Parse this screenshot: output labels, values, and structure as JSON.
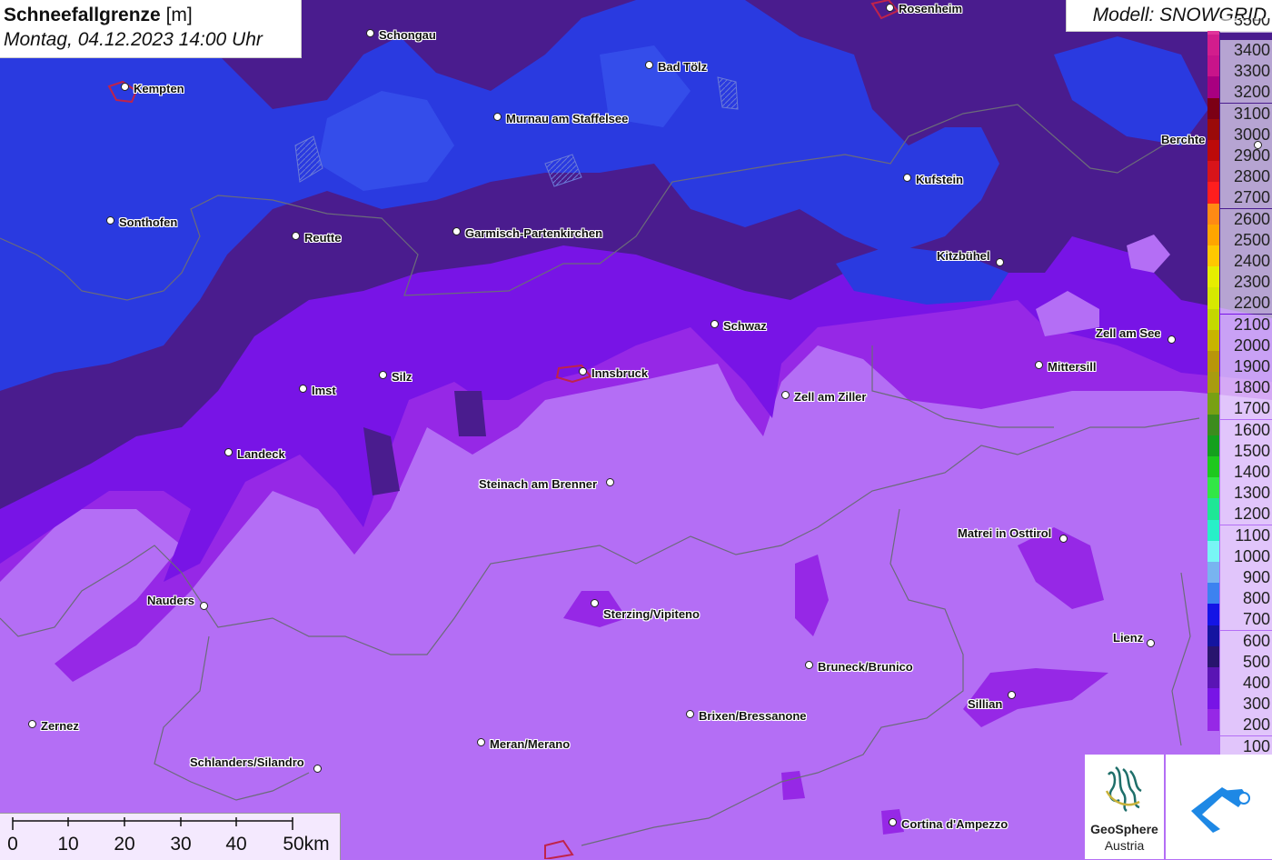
{
  "header": {
    "title_bold": "Schneefallgrenze",
    "title_unit": "[m]",
    "datetime": "Montag, 04.12.2023 14:00 Uhr",
    "model": "Modell: SNOWGRID"
  },
  "legend": {
    "top_partial": "3500",
    "entries": [
      {
        "value": "3400",
        "color": "#d21d8d"
      },
      {
        "value": "3300",
        "color": "#c8148a"
      },
      {
        "value": "3200",
        "color": "#a80080"
      },
      {
        "value": "3100",
        "color": "#7c0015"
      },
      {
        "value": "3000",
        "color": "#9b0a0a"
      },
      {
        "value": "2900",
        "color": "#bd0a0a"
      },
      {
        "value": "2800",
        "color": "#d8141a"
      },
      {
        "value": "2700",
        "color": "#ff1e1e"
      },
      {
        "value": "2600",
        "color": "#ff8a14"
      },
      {
        "value": "2500",
        "color": "#ffa500"
      },
      {
        "value": "2400",
        "color": "#ffc800"
      },
      {
        "value": "2300",
        "color": "#e6ee00"
      },
      {
        "value": "2200",
        "color": "#d6e800"
      },
      {
        "value": "2100",
        "color": "#c4d800"
      },
      {
        "value": "2000",
        "color": "#c8b400"
      },
      {
        "value": "1900",
        "color": "#b8960a"
      },
      {
        "value": "1800",
        "color": "#a89c10"
      },
      {
        "value": "1700",
        "color": "#78a014"
      },
      {
        "value": "1600",
        "color": "#3c8c1e"
      },
      {
        "value": "1500",
        "color": "#14a01e"
      },
      {
        "value": "1400",
        "color": "#1ec81e"
      },
      {
        "value": "1300",
        "color": "#32e646"
      },
      {
        "value": "1200",
        "color": "#1ee696"
      },
      {
        "value": "1100",
        "color": "#28f0c8"
      },
      {
        "value": "1000",
        "color": "#78f5f5"
      },
      {
        "value": "900",
        "color": "#78b4f0"
      },
      {
        "value": "800",
        "color": "#3c82f0"
      },
      {
        "value": "700",
        "color": "#1414e6"
      },
      {
        "value": "600",
        "color": "#1414a0"
      },
      {
        "value": "500",
        "color": "#28146e"
      },
      {
        "value": "400",
        "color": "#5a14b4"
      },
      {
        "value": "300",
        "color": "#7814e6"
      },
      {
        "value": "200",
        "color": "#9628e6"
      },
      {
        "value": "100",
        "color": "#b46ef5"
      }
    ]
  },
  "cities": [
    {
      "name": "Rosenheim"
    },
    {
      "name": "Schongau"
    },
    {
      "name": "Kempten"
    },
    {
      "name": "Bad Tölz"
    },
    {
      "name": "Murnau am Staffelsee"
    },
    {
      "name": "Berchte"
    },
    {
      "name": "Kufstein"
    },
    {
      "name": "Sonthofen"
    },
    {
      "name": "Reutte"
    },
    {
      "name": "Garmisch-Partenkirchen"
    },
    {
      "name": "Kitzbühel"
    },
    {
      "name": "Schwaz"
    },
    {
      "name": "Zell am See"
    },
    {
      "name": "Mittersill"
    },
    {
      "name": "Innsbruck"
    },
    {
      "name": "Silz"
    },
    {
      "name": "Imst"
    },
    {
      "name": "Zell am Ziller"
    },
    {
      "name": "Landeck"
    },
    {
      "name": "Steinach am Brenner"
    },
    {
      "name": "Matrei in Osttirol"
    },
    {
      "name": "Nauders"
    },
    {
      "name": "Sterzing/Vipiteno"
    },
    {
      "name": "Lienz"
    },
    {
      "name": "Bruneck/Brunico"
    },
    {
      "name": "Sillian"
    },
    {
      "name": "Brixen/Bressanone"
    },
    {
      "name": "Zernez"
    },
    {
      "name": "Meran/Merano"
    },
    {
      "name": "Schlanders/Silandro"
    },
    {
      "name": "Cortina d'Ampezzo"
    }
  ],
  "scale": {
    "labels": [
      "0",
      "10",
      "20",
      "30",
      "40",
      "50km"
    ]
  },
  "logos": {
    "geosphere_line1": "GeoSphere",
    "geosphere_line2": "Austria"
  }
}
